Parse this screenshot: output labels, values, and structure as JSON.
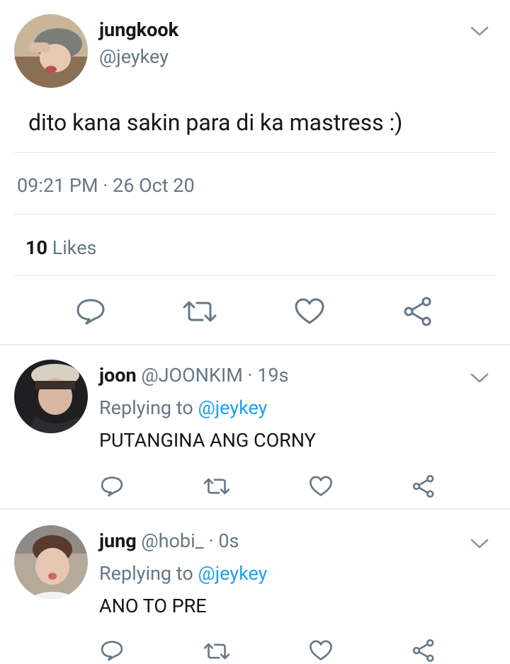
{
  "tweet": {
    "author_name": "jungkook",
    "author_handle": "@jeykey",
    "text": "dito kana sakin para di ka mastress :)",
    "time": "09:21 PM",
    "separator": "·",
    "date": "26 Oct 20",
    "likes_count": "10",
    "likes_label": "Likes"
  },
  "replies": [
    {
      "name": "joon",
      "handle": "@JOONKIM",
      "age": "· 19s",
      "replying_label": "Replying to",
      "replying_to": "@jeykey",
      "text": "PUTANGINA ANG CORNY"
    },
    {
      "name": "jung",
      "handle": "@hobi_",
      "age": "· 0s",
      "replying_label": "Replying to",
      "replying_to": "@jeykey",
      "text": "ANO TO PRE"
    }
  ],
  "icons": {
    "reply": "reply-icon",
    "retweet": "retweet-icon",
    "like": "heart-icon",
    "share": "share-icon",
    "more": "chevron-down-icon"
  },
  "colors": {
    "text": "#14171a",
    "muted": "#657786",
    "link": "#1da1f2",
    "divider": "#e1e8ed"
  }
}
